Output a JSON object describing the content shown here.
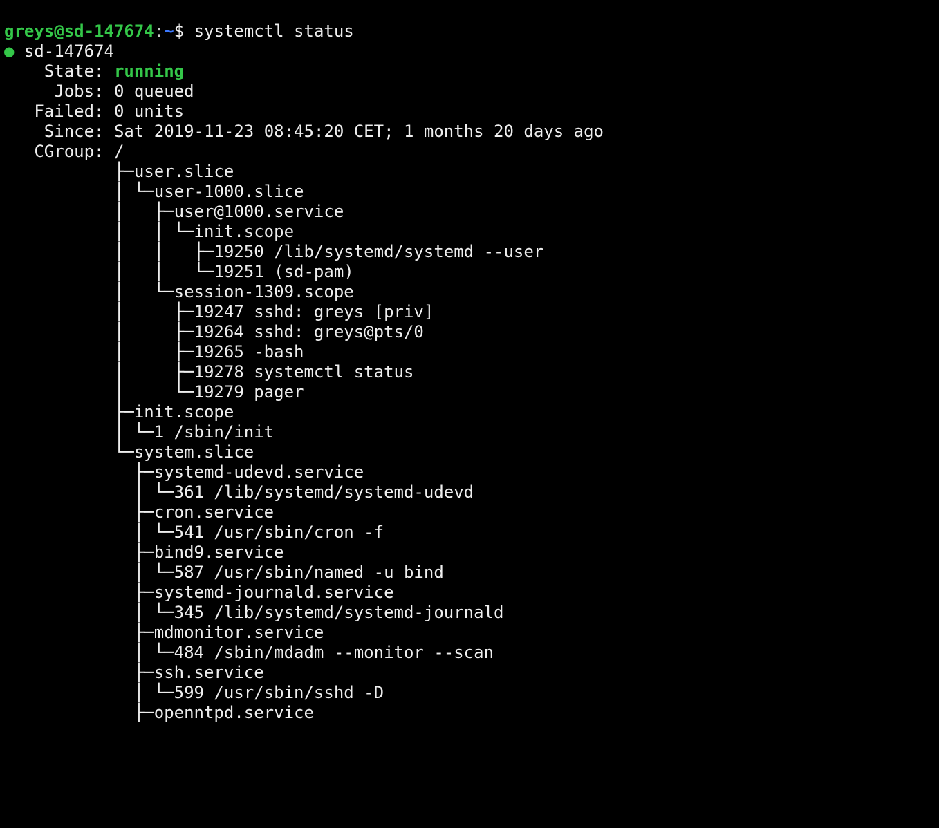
{
  "prompt": {
    "user": "greys",
    "at": "@",
    "host": "sd-147674",
    "colon": ":",
    "path": "~",
    "dollar": "$ ",
    "command": "systemctl status"
  },
  "header": {
    "dot": "●",
    "hostname": " sd-147674",
    "state_label": "    State: ",
    "state_value": "running",
    "jobs_label": "     Jobs: ",
    "jobs_value": "0 queued",
    "failed_label": "   Failed: ",
    "failed_value": "0 units",
    "since_label": "    Since: ",
    "since_value": "Sat 2019-11-23 08:45:20 CET; 1 months 20 days ago",
    "cgroup_label": "   CGroup: ",
    "cgroup_value": "/"
  },
  "tree": {
    "l01": "           ├─user.slice",
    "l02": "           │ └─user-1000.slice",
    "l03": "           │   ├─user@1000.service",
    "l04": "           │   │ └─init.scope",
    "l05": "           │   │   ├─19250 /lib/systemd/systemd --user",
    "l06": "           │   │   └─19251 (sd-pam)",
    "l07": "           │   └─session-1309.scope",
    "l08": "           │     ├─19247 sshd: greys [priv]",
    "l09": "           │     ├─19264 sshd: greys@pts/0",
    "l10": "           │     ├─19265 -bash",
    "l11": "           │     ├─19278 systemctl status",
    "l12": "           │     └─19279 pager",
    "l13": "           ├─init.scope",
    "l14": "           │ └─1 /sbin/init",
    "l15": "           └─system.slice",
    "l16": "             ├─systemd-udevd.service",
    "l17": "             │ └─361 /lib/systemd/systemd-udevd",
    "l18": "             ├─cron.service",
    "l19": "             │ └─541 /usr/sbin/cron -f",
    "l20": "             ├─bind9.service",
    "l21": "             │ └─587 /usr/sbin/named -u bind",
    "l22": "             ├─systemd-journald.service",
    "l23": "             │ └─345 /lib/systemd/systemd-journald",
    "l24": "             ├─mdmonitor.service",
    "l25": "             │ └─484 /sbin/mdadm --monitor --scan",
    "l26": "             ├─ssh.service",
    "l27": "             │ └─599 /usr/sbin/sshd -D",
    "l28": "             ├─openntpd.service"
  }
}
